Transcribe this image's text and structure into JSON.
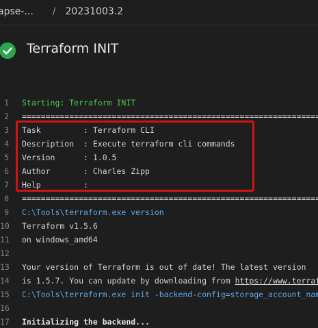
{
  "breadcrumb": {
    "pipeline": "apse-...",
    "separator": "/",
    "run": "20231003.2"
  },
  "task": {
    "title": "Terraform INIT",
    "status_icon": "success-check-icon",
    "status_color": "#2da44e"
  },
  "log": {
    "lines": [
      {
        "num": "1",
        "parts": [
          {
            "text": "Starting: Terraform INIT",
            "style": "green"
          }
        ]
      },
      {
        "num": "2",
        "parts": [
          {
            "text": "================================================================================",
            "style": "normal"
          }
        ]
      },
      {
        "num": "3",
        "parts": [
          {
            "text": "Task         : Terraform CLI",
            "style": "normal"
          }
        ]
      },
      {
        "num": "4",
        "parts": [
          {
            "text": "Description  : Execute terraform cli commands",
            "style": "normal"
          }
        ]
      },
      {
        "num": "5",
        "parts": [
          {
            "text": "Version      : 1.0.5",
            "style": "normal"
          }
        ]
      },
      {
        "num": "6",
        "parts": [
          {
            "text": "Author       : Charles Zipp",
            "style": "normal"
          }
        ]
      },
      {
        "num": "7",
        "parts": [
          {
            "text": "Help         :",
            "style": "normal"
          }
        ]
      },
      {
        "num": "8",
        "parts": [
          {
            "text": "================================================================================",
            "style": "normal"
          }
        ]
      },
      {
        "num": "9",
        "parts": [
          {
            "text": "C:\\Tools\\terraform.exe version",
            "style": "blue"
          }
        ]
      },
      {
        "num": "10",
        "parts": [
          {
            "text": "Terraform v1.5.6",
            "style": "normal"
          }
        ]
      },
      {
        "num": "11",
        "parts": [
          {
            "text": "on windows_amd64",
            "style": "normal"
          }
        ]
      },
      {
        "num": "12",
        "parts": []
      },
      {
        "num": "13",
        "parts": [
          {
            "text": "Your version of Terraform is out of date! The latest version",
            "style": "normal"
          }
        ]
      },
      {
        "num": "14",
        "parts": [
          {
            "text": "is 1.5.7. You can update by downloading from ",
            "style": "normal"
          },
          {
            "text": "https://www.terraform.io/downloads.html",
            "style": "link"
          }
        ]
      },
      {
        "num": "15",
        "parts": [
          {
            "text": "C:\\Tools\\terraform.exe init -backend-config=storage_account_name=st",
            "style": "blue"
          }
        ]
      },
      {
        "num": "16",
        "parts": []
      },
      {
        "num": "17",
        "parts": [
          {
            "text": "Initializing the backend...",
            "style": "bold"
          }
        ]
      }
    ]
  }
}
